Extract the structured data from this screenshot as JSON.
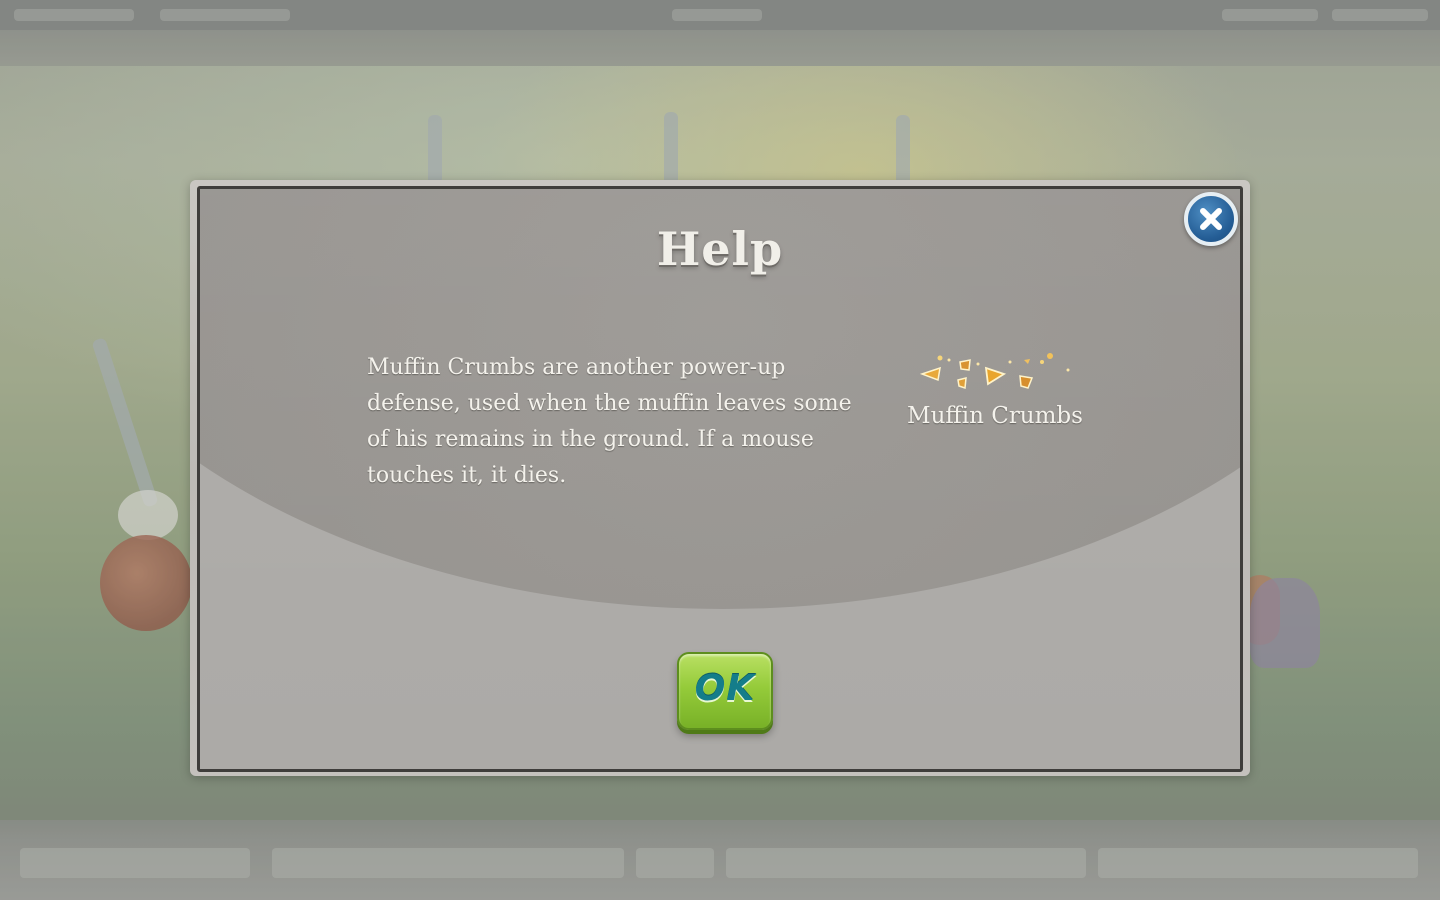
{
  "dialog": {
    "title": "Help",
    "description": "Muffin Crumbs are another power-up defense, used when the muffin leaves some of his remains in the ground. If a mouse touches it, it dies.",
    "item": {
      "label": "Muffin Crumbs",
      "icon": "muffin-crumbs-icon"
    },
    "ok_label": "OK",
    "close_icon": "close-icon"
  },
  "colors": {
    "panel": "#9a9793",
    "panel_border": "#3f3d3b",
    "text": "#f4f2ec",
    "ok_button": "#95cb3a",
    "ok_text": "#147d8a",
    "close_button": "#245d95"
  }
}
